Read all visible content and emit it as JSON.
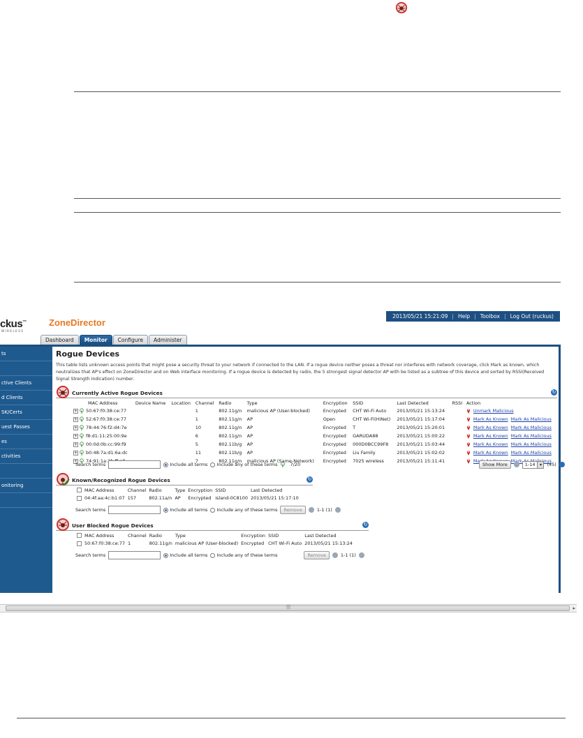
{
  "brand": {
    "logo_text": "ckus",
    "logo_tm": "™",
    "logo_sub": "WIRELESS",
    "product": "ZoneDirector"
  },
  "top_bar": {
    "datetime": "2013/05/21  15:21:09",
    "sep": "|",
    "help": "Help",
    "toolbox": "Toolbox",
    "logout": "Log Out (ruckus)"
  },
  "tabs": [
    {
      "label": "Dashboard"
    },
    {
      "label": "Monitor"
    },
    {
      "label": "Configure"
    },
    {
      "label": "Administer"
    }
  ],
  "sidebar": {
    "items": [
      {
        "label": "ts"
      },
      {
        "label": ""
      },
      {
        "label": "ctive Clients"
      },
      {
        "label": "d Clients"
      },
      {
        "label": "SK/Certs"
      },
      {
        "label": "uest Passes"
      },
      {
        "label": "es"
      },
      {
        "label": "ctivities"
      },
      {
        "label": ""
      },
      {
        "label": "onitoring"
      },
      {
        "label": ""
      }
    ]
  },
  "page": {
    "title": "Rogue Devices",
    "description": "This table lists unknown access points that might pose a security threat to your network if connected to the LAN. If a rogue device neither poses a threat nor interferes with network coverage, click Mark as known, which neutralizes that AP's effect on ZoneDirector and on Web interface monitoring. If a rogue device is detected by radio, the 5 strongest signal detector AP with be listed as a subtree of this device and sorted by RSSI(Received Signal Strength Indication) number."
  },
  "active": {
    "title": "Currently Active Rogue Devices",
    "columns": [
      "MAC Address",
      "Device Name",
      "Location",
      "Channel",
      "Radio",
      "Type",
      "Encryption",
      "SSID",
      "Last Detected",
      "RSSI",
      "Action"
    ],
    "rows": [
      {
        "mac": "50:67:f0:38:ce:77",
        "name": "",
        "location": "",
        "channel": "1",
        "radio": "802.11g/n",
        "type": "malicious AP (User-blocked)",
        "encryption": "Encrypted",
        "ssid": "CHT Wi-Fi Auto",
        "last": "2013/05/21  15:13:24",
        "rssi": "",
        "action1": "Unmark Malicious",
        "action2": ""
      },
      {
        "mac": "52:67:f0:38:ce:77",
        "name": "",
        "location": "",
        "channel": "1",
        "radio": "802.11g/n",
        "type": "AP",
        "encryption": "Open",
        "ssid": "CHT Wi-Fi(HiNet)",
        "last": "2013/05/21  15:17:04",
        "rssi": "",
        "action1": "Mark As Known",
        "action2": "Mark As Malicious"
      },
      {
        "mac": "78:44:76:f2:d4:7e",
        "name": "",
        "location": "",
        "channel": "10",
        "radio": "802.11g/n",
        "type": "AP",
        "encryption": "Encrypted",
        "ssid": "T",
        "last": "2013/05/21  15:20:01",
        "rssi": "",
        "action1": "Mark As Known",
        "action2": "Mark As Malicious"
      },
      {
        "mac": "f8:d1:11:25:00:9e",
        "name": "",
        "location": "",
        "channel": "6",
        "radio": "802.11g/n",
        "type": "AP",
        "encryption": "Encrypted",
        "ssid": "GARUDA88",
        "last": "2013/05/21  15:00:22",
        "rssi": "",
        "action1": "Mark As Known",
        "action2": "Mark As Malicious"
      },
      {
        "mac": "00:0d:0b:cc:99:f9",
        "name": "",
        "location": "",
        "channel": "5",
        "radio": "802.11b/g",
        "type": "AP",
        "encryption": "Encrypted",
        "ssid": "000D0BCC99F8",
        "last": "2013/05/21  15:03:44",
        "rssi": "",
        "action1": "Mark As Known",
        "action2": "Mark As Malicious"
      },
      {
        "mac": "b0:48:7a:d1:6a:dc",
        "name": "",
        "location": "",
        "channel": "11",
        "radio": "802.11b/g",
        "type": "AP",
        "encryption": "Encrypted",
        "ssid": "Liu Family",
        "last": "2013/05/21  15:02:02",
        "rssi": "",
        "action1": "Mark As Known",
        "action2": "Mark As Malicious"
      },
      {
        "mac": "74:91:1a:2b:ff:a8",
        "name": "",
        "location": "",
        "channel": "7",
        "radio": "802.11g/n",
        "type": "malicious AP (Same-Network)",
        "encryption": "Encrypted",
        "ssid": "7025 wireless",
        "last": "2013/05/21  15:11:41",
        "rssi": "",
        "action1": "Mark As Known",
        "action2": "Mark As Malicious"
      }
    ],
    "search_label": "Search terms",
    "opt_all": "Include all terms",
    "opt_any": "Include any of these terms",
    "count": "7/20",
    "show_more": "Show More",
    "page_range": "1-14",
    "total": "(45)"
  },
  "known": {
    "title": "Known/Recognized Rogue Devices",
    "columns": [
      "MAC Address",
      "Channel",
      "Radio",
      "Type",
      "Encryption",
      "SSID",
      "Last Detected"
    ],
    "rows": [
      {
        "mac": "04:4f:aa:4c:b1:07",
        "channel": "157",
        "radio": "802.11a/n",
        "type": "AP",
        "encryption": "Encrypted",
        "ssid": "island-0C8100",
        "last": "2013/05/21  15:17:10"
      }
    ],
    "search_label": "Search terms",
    "opt_all": "Include all terms",
    "opt_any": "Include any of these terms",
    "remove": "Remove",
    "pager": "1-1 (1)"
  },
  "blocked": {
    "title": "User Blocked Rogue Devices",
    "columns": [
      "MAC Address",
      "Channel",
      "Radio",
      "Type",
      "Encryption",
      "SSID",
      "Last Detected"
    ],
    "rows": [
      {
        "mac": "50:67:f0:38:ce:77",
        "channel": "1",
        "radio": "802.11g/n",
        "type": "malicious AP (User-blocked)",
        "encryption": "Encrypted",
        "ssid": "CHT Wi-Fi Auto",
        "last": "2013/05/21  15:13:24"
      }
    ],
    "search_label": "Search terms",
    "opt_all": "Include all terms",
    "opt_any": "Include any of these terms",
    "remove": "Remove",
    "pager": "1-1 (1)"
  },
  "colors": {
    "brand_orange": "#e87722",
    "nav_blue": "#1f5a8f",
    "link_blue": "#1a3fa8"
  }
}
